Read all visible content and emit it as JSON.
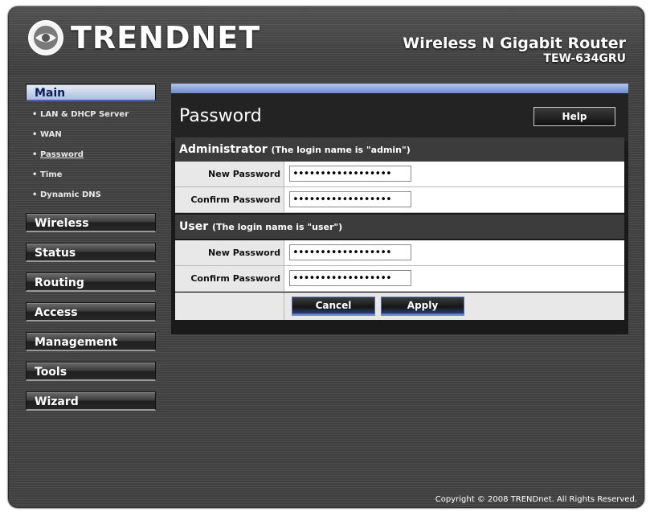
{
  "header": {
    "brand": "TRENDNET",
    "product_name": "Wireless N Gigabit Router",
    "model": "TEW-634GRU"
  },
  "sidebar": {
    "main_label": "Main",
    "sub_items": [
      {
        "label": "LAN & DHCP Server"
      },
      {
        "label": "WAN"
      },
      {
        "label": "Password",
        "active": true
      },
      {
        "label": "Time"
      },
      {
        "label": "Dynamic DNS"
      }
    ],
    "menus": [
      "Wireless",
      "Status",
      "Routing",
      "Access",
      "Management",
      "Tools",
      "Wizard"
    ]
  },
  "content": {
    "title": "Password",
    "help_label": "Help",
    "admin_section": {
      "title": "Administrator",
      "note": "(The login name is \"admin\")",
      "new_password_label": "New Password",
      "new_password_value": "••••••••••••••••••",
      "confirm_password_label": "Confirm Password",
      "confirm_password_value": "••••••••••••••••••"
    },
    "user_section": {
      "title": "User",
      "note": "(The login name is \"user\")",
      "new_password_label": "New Password",
      "new_password_value": "••••••••••••••••••",
      "confirm_password_label": "Confirm Password",
      "confirm_password_value": "••••••••••••••••••"
    },
    "cancel_label": "Cancel",
    "apply_label": "Apply"
  },
  "footer": {
    "copyright": "Copyright © 2008 TRENDnet. All Rights Reserved."
  },
  "colors": {
    "accent_blue": "#6f8cc9",
    "main_menu_bg": "#c8d4ea",
    "background": "#404040"
  }
}
